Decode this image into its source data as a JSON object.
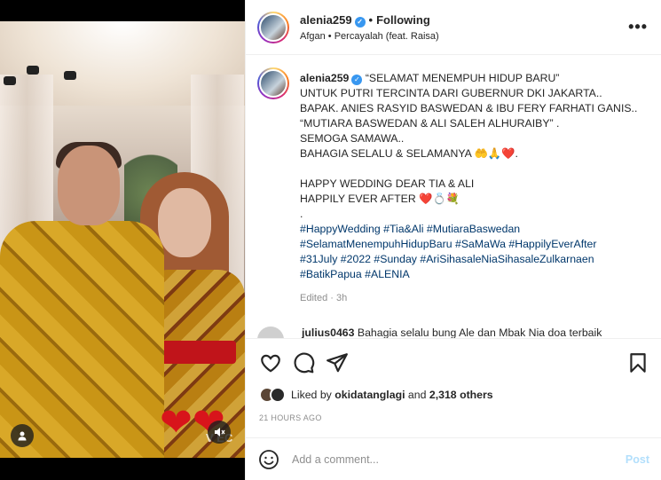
{
  "colors": {
    "accent": "#0095f6",
    "verified": "#3897f0",
    "link": "#00376b",
    "muted": "#8e8e8e"
  },
  "header": {
    "username": "alenia259",
    "separator": "•",
    "follow_status": "Following",
    "audio": "Afgan • Percayalah (feat. Raisa)",
    "more_icon": "more-horizontal-icon"
  },
  "media": {
    "watermark": "V     EC",
    "user_tag_icon": "user-tag-icon",
    "mute_icon": "speaker-muted-icon"
  },
  "caption": {
    "username": "alenia259",
    "lines": [
      "“SELAMAT MENEMPUH HIDUP BARU”",
      "UNTUK PUTRI TERCINTA DARI GUBERNUR DKI JAKARTA..",
      "BAPAK. ANIES RASYID BASWEDAN & IBU FERY FARHATI GANIS..",
      "“MUTIARA BASWEDAN & ALI SALEH ALHURAIBY” .",
      "SEMOGA SAMAWA..",
      "BAHAGIA SELALU & SELAMANYA 🤲🙏❤️.",
      "",
      "HAPPY WEDDING DEAR TIA & ALI",
      "HAPPILY EVER AFTER ❤️💍💐",
      "."
    ],
    "hashtag_lines": [
      "#HappyWedding #Tia&Ali #MutiaraBaswedan",
      "#SelamatMenempuhHidupBaru #SaMaWa #HappilyEverAfter",
      "#31July #2022 #Sunday #AriSihasaleNiaSihasaleZulkarnaen",
      "#BatikPapua #ALENIA"
    ],
    "edited": "Edited · 3h"
  },
  "comment": {
    "username": "julius0463",
    "text": "Bahagia selalu bung Ale dan Mbak Nia doa terbaik"
  },
  "actions": {
    "like_icon": "heart-icon",
    "comment_icon": "comment-icon",
    "share_icon": "share-icon",
    "save_icon": "bookmark-icon"
  },
  "likes": {
    "prefix": "Liked by",
    "user": "okidatanglagi",
    "middle": "and",
    "count": "2,318 others"
  },
  "timestamp": "21 HOURS AGO",
  "add_comment": {
    "placeholder": "Add a comment...",
    "post_label": "Post",
    "emoji_icon": "emoji-icon"
  }
}
